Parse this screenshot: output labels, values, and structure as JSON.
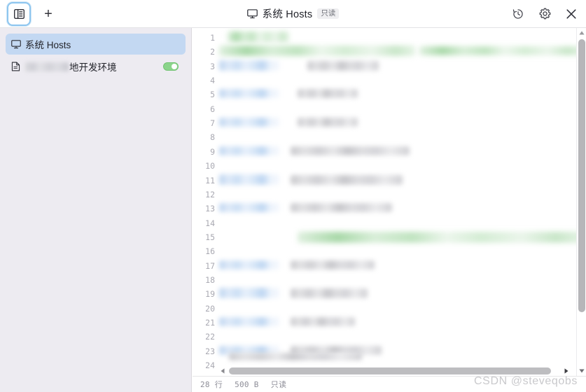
{
  "window": {
    "title": "系统 Hosts",
    "title_icon": "monitor-icon",
    "readonly_badge": "只读"
  },
  "titlebar": {
    "sidebar_toggle_icon": "sidebar-panel-icon",
    "new_tab_label": "+",
    "history_icon": "history-clock-icon",
    "settings_icon": "gear-icon",
    "close_icon": "close-icon"
  },
  "sidebar": {
    "items": [
      {
        "label": "系统 Hosts",
        "icon": "monitor-icon",
        "selected": true,
        "has_toggle": false
      },
      {
        "label": "地开发环境",
        "icon": "document-icon",
        "selected": false,
        "has_toggle": true,
        "toggle_on": true,
        "redacted_prefix": true
      }
    ]
  },
  "editor": {
    "line_numbers": [
      "1",
      "2",
      "3",
      "4",
      "5",
      "6",
      "7",
      "8",
      "9",
      "10",
      "11",
      "12",
      "13",
      "14",
      "15",
      "16",
      "17",
      "18",
      "19",
      "20",
      "21",
      "22",
      "23",
      "24"
    ],
    "comment_line_1": "地开发环境",
    "comment_line_1_hash": "#",
    "comment_line_15": "应用服务器",
    "comment_line_15_hash": "#",
    "redacted": true
  },
  "statusbar": {
    "lines": "28 行",
    "size": "500 B",
    "mode": "只读"
  },
  "watermark": {
    "text": "CSDN @steveqobs"
  },
  "colors": {
    "accent_blue": "#c3d8f2",
    "sidebar_bg": "#edebf1",
    "comment_green": "#2f9e44",
    "toggle_on": "#8bd48b",
    "focus_ring": "#8ec6ef"
  }
}
